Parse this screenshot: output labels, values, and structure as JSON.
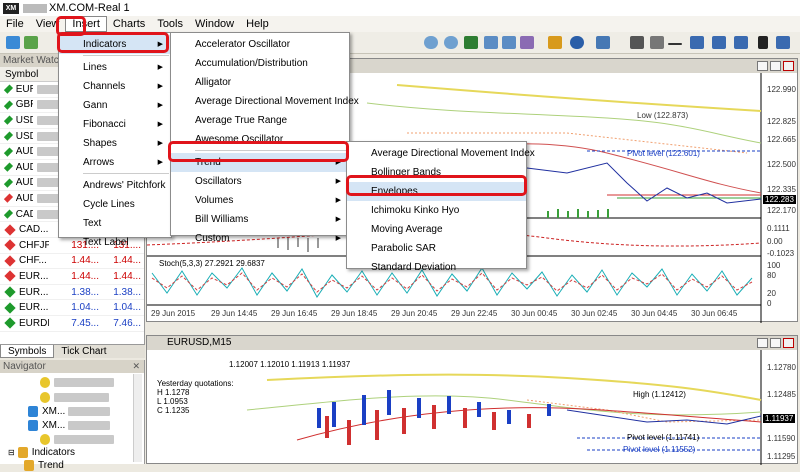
{
  "title": "XM.COM-Real 1",
  "menubar": [
    "File",
    "View",
    "Insert",
    "Charts",
    "Tools",
    "Window",
    "Help"
  ],
  "insert_menu": {
    "items": [
      {
        "label": "Indicators",
        "submenu": true
      },
      {
        "label": "Lines",
        "submenu": true
      },
      {
        "label": "Channels",
        "submenu": true
      },
      {
        "label": "Gann",
        "submenu": true
      },
      {
        "label": "Fibonacci",
        "submenu": true
      },
      {
        "label": "Shapes",
        "submenu": true
      },
      {
        "label": "Arrows",
        "submenu": true
      },
      {
        "label": "Andrews' Pitchfork",
        "submenu": false
      },
      {
        "label": "Cycle Lines",
        "submenu": false
      },
      {
        "label": "Text",
        "submenu": false
      },
      {
        "label": "Text Label",
        "submenu": false
      }
    ]
  },
  "indicators_menu": {
    "items": [
      {
        "label": "Accelerator Oscillator",
        "submenu": false
      },
      {
        "label": "Accumulation/Distribution",
        "submenu": false
      },
      {
        "label": "Alligator",
        "submenu": false
      },
      {
        "label": "Average Directional Movement Index",
        "submenu": false
      },
      {
        "label": "Average True Range",
        "submenu": false
      },
      {
        "label": "Awesome Oscillator",
        "submenu": false
      },
      {
        "label": "Trend",
        "submenu": true
      },
      {
        "label": "Oscillators",
        "submenu": true
      },
      {
        "label": "Volumes",
        "submenu": true
      },
      {
        "label": "Bill Williams",
        "submenu": true
      },
      {
        "label": "Custom",
        "submenu": true
      }
    ]
  },
  "trend_menu": {
    "items": [
      "Average Directional Movement Index",
      "Bollinger Bands",
      "Envelopes",
      "Ichimoku Kinko Hyo",
      "Moving Average",
      "Parabolic SAR",
      "Standard Deviation"
    ]
  },
  "market_watch": {
    "header": "Market Watch:",
    "column": "Symbol",
    "rows": [
      {
        "sym": "EUR...",
        "bid": "",
        "ask": "",
        "color": "#1e9a2c",
        "price_color": "red"
      },
      {
        "sym": "GBP...",
        "bid": "",
        "ask": "",
        "color": "#1e9a2c",
        "price_color": "red"
      },
      {
        "sym": "USDJPY",
        "bid": "",
        "ask": "",
        "color": "#1e9a2c",
        "price_color": "red"
      },
      {
        "sym": "USD...",
        "bid": "",
        "ask": "",
        "color": "#1e9a2c",
        "price_color": "red"
      },
      {
        "sym": "AUD...",
        "bid": "",
        "ask": "",
        "color": "#1e9a2c",
        "price_color": "red"
      },
      {
        "sym": "AUD...",
        "bid": "",
        "ask": "",
        "color": "#1e9a2c",
        "price_color": "red"
      },
      {
        "sym": "AUDJPY",
        "bid": "",
        "ask": "",
        "color": "#1e9a2c",
        "price_color": "red"
      },
      {
        "sym": "AUD...",
        "bid": "",
        "ask": "",
        "color": "#d33",
        "price_color": "red"
      },
      {
        "sym": "CADJPY",
        "bid": "",
        "ask": "",
        "color": "#1e9a2c",
        "price_color": "red"
      },
      {
        "sym": "CAD...",
        "bid": "0.75...",
        "ask": "0.75...",
        "color": "#d33",
        "price_color": "red"
      },
      {
        "sym": "CHFJPY",
        "bid": "131....",
        "ask": "131....",
        "color": "#d33",
        "price_color": "red"
      },
      {
        "sym": "CHF...",
        "bid": "1.44...",
        "ask": "1.44...",
        "color": "#d33",
        "price_color": "red"
      },
      {
        "sym": "EUR...",
        "bid": "1.44...",
        "ask": "1.44...",
        "color": "#d33",
        "price_color": "red"
      },
      {
        "sym": "EUR...",
        "bid": "1.38...",
        "ask": "1.38...",
        "color": "#1e9a2c",
        "price_color": "blue"
      },
      {
        "sym": "EUR...",
        "bid": "1.04...",
        "ask": "1.04...",
        "color": "#1e9a2c",
        "price_color": "blue"
      },
      {
        "sym": "EURDKK",
        "bid": "7.45...",
        "ask": "7.46...",
        "color": "#1e9a2c",
        "price_color": "blue"
      }
    ],
    "tabs": [
      "Symbols",
      "Tick Chart"
    ]
  },
  "navigator": {
    "header": "Navigator",
    "items": [
      {
        "label": "XM...",
        "indent": 2
      },
      {
        "label": "XM...",
        "indent": 2
      },
      {
        "label": "Indicators",
        "indent": 1
      },
      {
        "label": "Trend",
        "indent": 2
      }
    ]
  },
  "chart1": {
    "prices": [
      "122.990",
      "122.825",
      "122.665",
      "122.500",
      "122.335",
      "122.283",
      "122.170",
      "122.005"
    ],
    "low_label": "Low (122.873)",
    "pivot_label": "Pivot level (122.601)",
    "indicator_vals": [
      "0.1111",
      "0.00",
      "-0.1023"
    ],
    "stoch_label": "Stoch(5,3,3) 27.2921 29.6837",
    "stoch_levels": [
      "100",
      "80",
      "20",
      "0"
    ],
    "time_labels": [
      "29 Jun 2015",
      "29 Jun 14:45",
      "29 Jun 16:45",
      "29 Jun 18:45",
      "29 Jun 20:45",
      "29 Jun 22:45",
      "30 Jun 00:45",
      "30 Jun 02:45",
      "30 Jun 04:45",
      "30 Jun 06:45"
    ]
  },
  "chart2": {
    "title": "EURUSD,M15",
    "ohlc": "1.12007 1.12010 1.11913 1.11937",
    "yesterday": "Yesterday quotations:",
    "h": "H 1.1278",
    "l": "L 1.0953",
    "c": "C 1.1235",
    "high_label": "High (1.12412)",
    "pivot_label": "Pivot level (1.11741)",
    "pivot2_label": "Pivot level (1.11552)",
    "prices": [
      "1.12780",
      "1.12485",
      "1.11937",
      "1.11590",
      "1.11295"
    ]
  },
  "colors": {
    "highlight_box": "#e0141b",
    "accent": "#1a3fc4"
  }
}
